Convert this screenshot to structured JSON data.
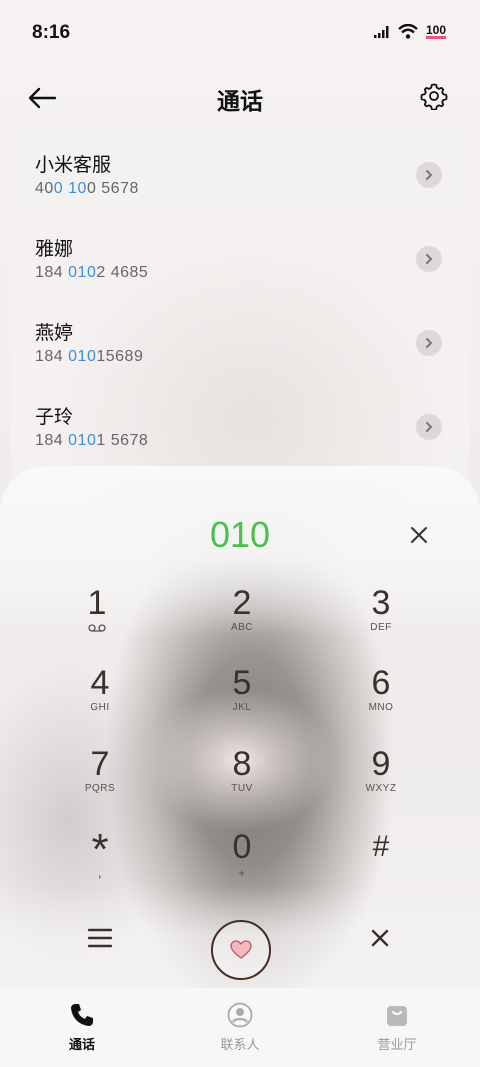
{
  "status": {
    "time": "8:16",
    "battery": "100"
  },
  "header": {
    "title": "通话"
  },
  "contacts": [
    {
      "name": "小米客服",
      "num_parts": [
        "40",
        "0 10",
        "0 5678"
      ]
    },
    {
      "name": "雅娜",
      "num_parts": [
        "184 ",
        "010",
        "2 4685"
      ]
    },
    {
      "name": "燕婷",
      "num_parts": [
        "184 ",
        "010",
        "15689"
      ]
    },
    {
      "name": "子玲",
      "num_parts": [
        "184 ",
        "010",
        "1 5678"
      ]
    }
  ],
  "dialer": {
    "number": "010",
    "keys": [
      {
        "digit": "1",
        "letters": ""
      },
      {
        "digit": "2",
        "letters": "ABC"
      },
      {
        "digit": "3",
        "letters": "DEF"
      },
      {
        "digit": "4",
        "letters": "GHI"
      },
      {
        "digit": "5",
        "letters": "JKL"
      },
      {
        "digit": "6",
        "letters": "MNO"
      },
      {
        "digit": "7",
        "letters": "PQRS"
      },
      {
        "digit": "8",
        "letters": "TUV"
      },
      {
        "digit": "9",
        "letters": "WXYZ"
      },
      {
        "digit": "*",
        "letters": ","
      },
      {
        "digit": "0",
        "letters": "+"
      },
      {
        "digit": "#",
        "letters": ""
      }
    ]
  },
  "tabs": [
    {
      "label": "通话",
      "icon": "phone-icon",
      "active": true
    },
    {
      "label": "联系人",
      "icon": "person-icon",
      "active": false
    },
    {
      "label": "营业厅",
      "icon": "bag-icon",
      "active": false
    }
  ],
  "colors": {
    "accent_green": "#4cbf4c",
    "highlight_blue": "#3b8fe0"
  }
}
